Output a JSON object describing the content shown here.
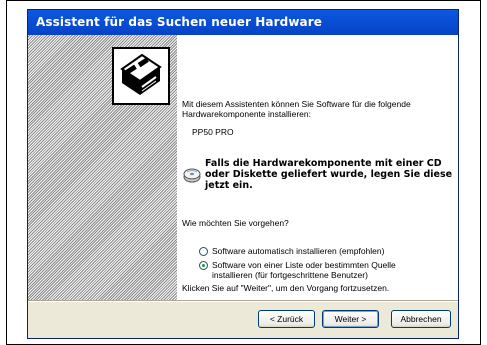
{
  "window": {
    "title": "Assistent für das Suchen neuer Hardware"
  },
  "content": {
    "intro": "Mit diesem Assistenten können Sie Software für die folgende Hardwarekomponente installieren:",
    "device_name": "PP50 PRO",
    "cd_message": "Falls die Hardwarekomponente mit einer CD oder Diskette geliefert wurde, legen Sie diese jetzt ein.",
    "question": "Wie möchten Sie vorgehen?",
    "options": [
      {
        "label": "Software automatisch installieren (empfohlen)",
        "selected": false
      },
      {
        "label_line1": "Software von einer Liste oder bestimmten Quelle",
        "label_line2": "installieren (für fortgeschrittene Benutzer)",
        "selected": true
      }
    ],
    "hint": "Klicken Sie auf \"Weiter\", um den Vorgang fortzusetzen."
  },
  "buttons": {
    "back": "< Zurück",
    "next": "Weiter >",
    "cancel": "Abbrechen"
  },
  "colors": {
    "titlebar": "#0a4fd6",
    "dialog_bg": "#ece9d8",
    "radio_selected": "#21a121"
  },
  "icons": {
    "wizard": "hardware-card-icon",
    "cd": "cd-icon"
  }
}
